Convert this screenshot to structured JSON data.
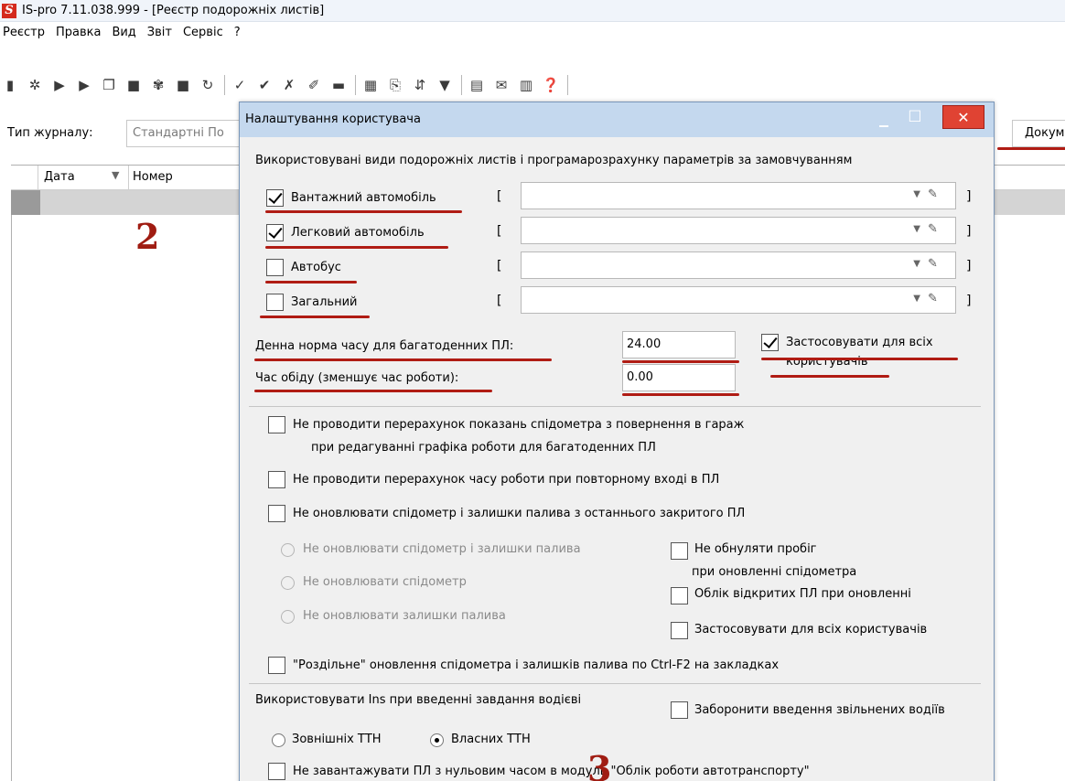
{
  "window": {
    "title": "IS-pro 7.11.038.999 - [Реєстр подорожніх листів]",
    "logo": "S"
  },
  "menu": [
    "Реєстр",
    "Правка",
    "Вид",
    "Звіт",
    "Сервіс",
    "?"
  ],
  "toolbar": {
    "icons": [
      "new-doc-icon",
      "create-icon",
      "open-icon",
      "edit-icon",
      "copy-icon",
      "delete-icon",
      "properties-icon",
      "print-icon",
      "refresh-icon",
      "check-icon",
      "double-check-icon",
      "uncheck-icon",
      "pin-icon",
      "stack-icon",
      "table-icon",
      "export-icon",
      "sort-icon",
      "filter-icon",
      "page-icon",
      "mail-icon",
      "columns-icon",
      "help-icon"
    ]
  },
  "journal": {
    "label": "Тип журналу:",
    "value": "Стандартні По",
    "doc_value": "Докум"
  },
  "grid": {
    "col1": "Дата",
    "col2": "Номер"
  },
  "marks": {
    "step2": "2",
    "step3": "3"
  },
  "dialog": {
    "title": "Налаштування користувача",
    "section_heading": "Використовувані види подорожніх листів і програмарозрахунку параметрів за замовчуванням",
    "vehicle_types": [
      {
        "label": "Вантажний автомобіль",
        "checked": true
      },
      {
        "label": "Легковий автомобіль",
        "checked": true
      },
      {
        "label": "Автобус",
        "checked": false
      },
      {
        "label": "Загальний",
        "checked": false
      }
    ],
    "bracket_open": "[",
    "bracket_close": "]",
    "daily_norm_label": "Денна норма часу для багатоденних ПЛ:",
    "daily_norm_value": "24.00",
    "lunch_label": "Час обіду  (зменшує час роботи):",
    "lunch_value": "0.00",
    "apply_all_line1": "Застосовувати для всіх",
    "apply_all_line2": "користувачів",
    "opt1_line1": "Не проводити перерахунок показань спідометра з повернення в гараж",
    "opt1_line2": "при редагуванні графіка роботи для багатоденних ПЛ",
    "opt2": "Не проводити перерахунок часу роботи при повторному вході в ПЛ",
    "opt3": "Не оновлювати спідометр і залишки палива з останнього закритого ПЛ",
    "radio_a": "Не оновлювати спідометр і залишки палива",
    "radio_b": "Не оновлювати спідометр",
    "radio_c": "Не оновлювати залишки палива",
    "right1_line1": "Не обнуляти пробіг",
    "right1_line2": "при оновленні спідометра",
    "right2": "Облік відкритих ПЛ при оновленні",
    "right3": "Застосовувати для всіх користувачів",
    "opt4": "\"Роздільне\" оновлення спідометра і залишків палива по Ctrl-F2 на закладках",
    "ins_label": "Використовувати Ins при введенні завдання водієві",
    "forbid_fired": "Заборонити введення звільнених водіїв",
    "ins_external": "Зовнішніх ТТН",
    "ins_own": "Власних ТТН",
    "opt5": "Не завантажувати ПЛ з нульовим часом в модуль \"Облік роботи автотранспорту\""
  },
  "colors": {
    "accent_red": "#b01c14",
    "dialog_title_bg": "#c4d8ee",
    "close_button": "#e04333"
  }
}
